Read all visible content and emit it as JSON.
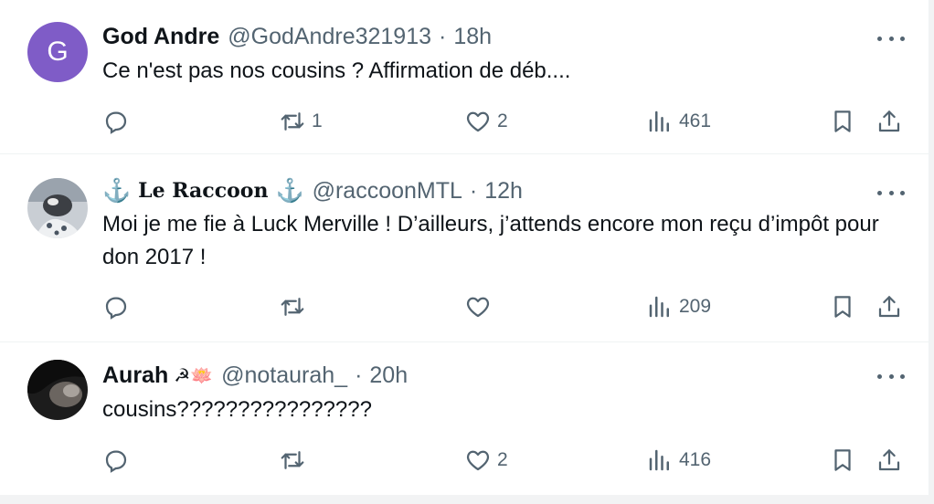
{
  "tweets": [
    {
      "avatar_letter": "G",
      "name": "God Andre",
      "handle": "@GodAndre321913",
      "time": "18h",
      "text": "Ce n'est pas nos cousins ? Affirmation de déb....",
      "replies": "",
      "retweets": "1",
      "likes": "2",
      "views": "461"
    },
    {
      "name": "Le Raccoon",
      "name_prefix_icon": "anchor-icon",
      "name_suffix_icon": "anchor-icon",
      "handle": "@raccoonMTL",
      "time": "12h",
      "text": "Moi je me fie à Luck Merville ! D’ailleurs, j’attends encore mon reçu d’impôt pour don 2017 !",
      "replies": "",
      "retweets": "",
      "likes": "",
      "views": "209"
    },
    {
      "name": "Aurah",
      "name_emoji": "☭🪷",
      "handle": "@notaurah_",
      "time": "20h",
      "text": "cousins????????????????",
      "replies": "",
      "retweets": "",
      "likes": "2",
      "views": "416"
    }
  ],
  "separator": "·",
  "colors": {
    "text": "#0f1419",
    "secondary": "#536471",
    "avatar_g": "#7f5cc7",
    "anchor": "#1d6fc4"
  }
}
